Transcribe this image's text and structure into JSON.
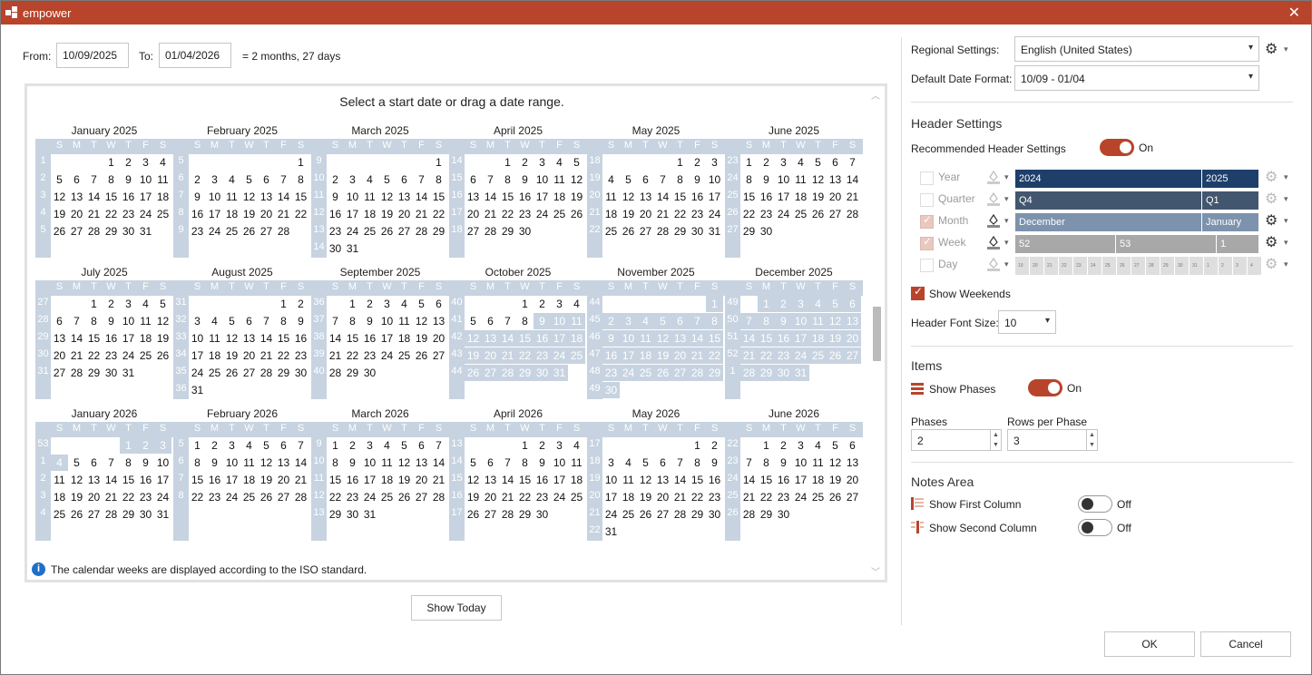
{
  "window": {
    "title": "empower"
  },
  "range": {
    "from_label": "From:",
    "from_value": "10/09/2025",
    "to_label": "To:",
    "to_value": "01/04/2026",
    "duration": "= 2 months, 27 days"
  },
  "calendar": {
    "hint": "Select a start date or drag a date range.",
    "dow": [
      "S",
      "M",
      "T",
      "W",
      "T",
      "F",
      "S"
    ],
    "months": [
      {
        "name": "January 2025",
        "weeks": [
          "1",
          "2",
          "3",
          "4",
          "5"
        ],
        "start": 3,
        "days": 31
      },
      {
        "name": "February 2025",
        "weeks": [
          "5",
          "6",
          "7",
          "8",
          "9"
        ],
        "start": 6,
        "days": 28
      },
      {
        "name": "March 2025",
        "weeks": [
          "9",
          "10",
          "11",
          "12",
          "13",
          "14"
        ],
        "start": 6,
        "days": 31
      },
      {
        "name": "April 2025",
        "weeks": [
          "14",
          "15",
          "16",
          "17",
          "18"
        ],
        "start": 2,
        "days": 30
      },
      {
        "name": "May 2025",
        "weeks": [
          "18",
          "19",
          "20",
          "21",
          "22"
        ],
        "start": 4,
        "days": 31
      },
      {
        "name": "June 2025",
        "weeks": [
          "23",
          "24",
          "25",
          "26",
          "27"
        ],
        "start": 0,
        "days": 30
      },
      {
        "name": "July 2025",
        "weeks": [
          "27",
          "28",
          "29",
          "30",
          "31"
        ],
        "start": 2,
        "days": 31
      },
      {
        "name": "August 2025",
        "weeks": [
          "31",
          "32",
          "33",
          "34",
          "35",
          "36"
        ],
        "start": 5,
        "days": 31
      },
      {
        "name": "September 2025",
        "weeks": [
          "36",
          "37",
          "38",
          "39",
          "40"
        ],
        "start": 1,
        "days": 30
      },
      {
        "name": "October 2025",
        "weeks": [
          "40",
          "41",
          "42",
          "43",
          "44"
        ],
        "start": 3,
        "days": 31,
        "selFrom": 9
      },
      {
        "name": "November 2025",
        "weeks": [
          "44",
          "45",
          "46",
          "47",
          "48",
          "49"
        ],
        "start": 6,
        "days": 30,
        "selFrom": 1
      },
      {
        "name": "December 2025",
        "weeks": [
          "49",
          "50",
          "51",
          "52",
          "1"
        ],
        "start": 1,
        "days": 31,
        "selFrom": 1
      },
      {
        "name": "January 2026",
        "weeks": [
          "53",
          "1",
          "2",
          "3",
          "4"
        ],
        "start": 4,
        "days": 31,
        "selFrom": 1,
        "selTo": 4
      },
      {
        "name": "February 2026",
        "weeks": [
          "5",
          "6",
          "7",
          "8"
        ],
        "start": 0,
        "days": 28
      },
      {
        "name": "March 2026",
        "weeks": [
          "9",
          "10",
          "11",
          "12",
          "13"
        ],
        "start": 0,
        "days": 31
      },
      {
        "name": "April 2026",
        "weeks": [
          "13",
          "14",
          "15",
          "16",
          "17"
        ],
        "start": 3,
        "days": 30
      },
      {
        "name": "May 2026",
        "weeks": [
          "17",
          "18",
          "19",
          "20",
          "21",
          "22"
        ],
        "start": 5,
        "days": 31
      },
      {
        "name": "June 2026",
        "weeks": [
          "22",
          "23",
          "24",
          "25",
          "26"
        ],
        "start": 1,
        "days": 30
      }
    ],
    "info": "The calendar weeks are displayed according to the ISO standard.",
    "show_today": "Show Today"
  },
  "settings": {
    "regional_label": "Regional Settings:",
    "regional_value": "English (United States)",
    "date_format_label": "Default Date Format:",
    "date_format_value": "10/09 - 01/04",
    "header_section": "Header Settings",
    "recommended_label": "Recommended Header Settings",
    "recommended_state": "On",
    "rows": [
      {
        "label": "Year",
        "bars": [
          {
            "text": "2024",
            "w": 206,
            "c": "#1f3f6b"
          },
          {
            "text": "2025",
            "w": 63,
            "c": "#1f3f6b"
          }
        ]
      },
      {
        "label": "Quarter",
        "bars": [
          {
            "text": "Q4",
            "w": 206,
            "c": "#43566f"
          },
          {
            "text": "Q1",
            "w": 63,
            "c": "#43566f"
          }
        ]
      },
      {
        "label": "Month",
        "bars": [
          {
            "text": "December",
            "w": 206,
            "c": "#7c92ad"
          },
          {
            "text": "January",
            "w": 63,
            "c": "#7c92ad"
          }
        ]
      },
      {
        "label": "Week",
        "bars": [
          {
            "text": "52",
            "w": 111,
            "c": "#a8a8a8"
          },
          {
            "text": "53",
            "w": 111,
            "c": "#a8a8a8"
          },
          {
            "text": "1",
            "w": 47,
            "c": "#a8a8a8"
          }
        ]
      },
      {
        "label": "Day",
        "days": [
          "19",
          "20",
          "21",
          "22",
          "23",
          "24",
          "25",
          "26",
          "27",
          "28",
          "29",
          "30",
          "31",
          "1",
          "2",
          "3",
          "4"
        ]
      }
    ],
    "show_weekends": "Show Weekends",
    "font_size_label": "Header Font Size:",
    "font_size_value": "10",
    "items_section": "Items",
    "show_phases": "Show Phases",
    "show_phases_state": "On",
    "phases_label": "Phases",
    "phases_value": "2",
    "rows_per_phase_label": "Rows per Phase",
    "rows_per_phase_value": "3",
    "notes_section": "Notes Area",
    "first_col": "Show First Column",
    "first_col_state": "Off",
    "second_col": "Show Second Column",
    "second_col_state": "Off"
  },
  "footer": {
    "ok": "OK",
    "cancel": "Cancel"
  }
}
